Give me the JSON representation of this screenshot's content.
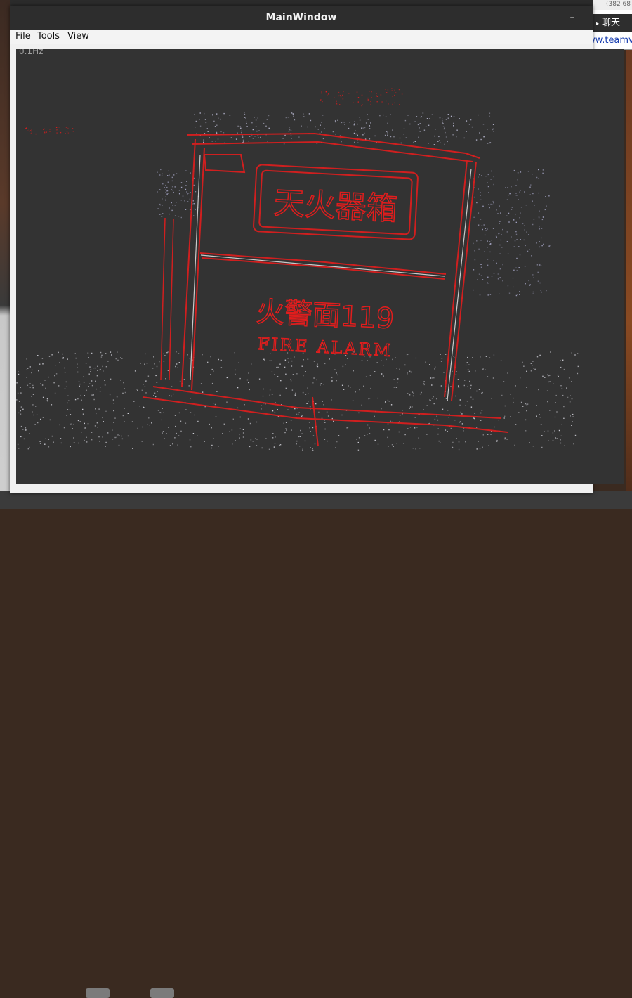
{
  "window": {
    "title": "MainWindow",
    "minimize_glyph": "–"
  },
  "menu": {
    "items": [
      "File",
      "Tools",
      "View"
    ]
  },
  "viewport": {
    "fps": "0.1Hz",
    "sign_text_top": "天火器箱",
    "sign_text_mid": "火警面119",
    "sign_text_bottom": "FIRE ALARM"
  },
  "side_panel": {
    "top_text": "(382 68",
    "chat_label": "聊天",
    "link_text": ".ww.teamvie"
  },
  "colors": {
    "accent": "#e11d1d",
    "points": "#c8c8d8",
    "viewport_bg": "#333333",
    "titlebar": "#2d2d2d"
  }
}
